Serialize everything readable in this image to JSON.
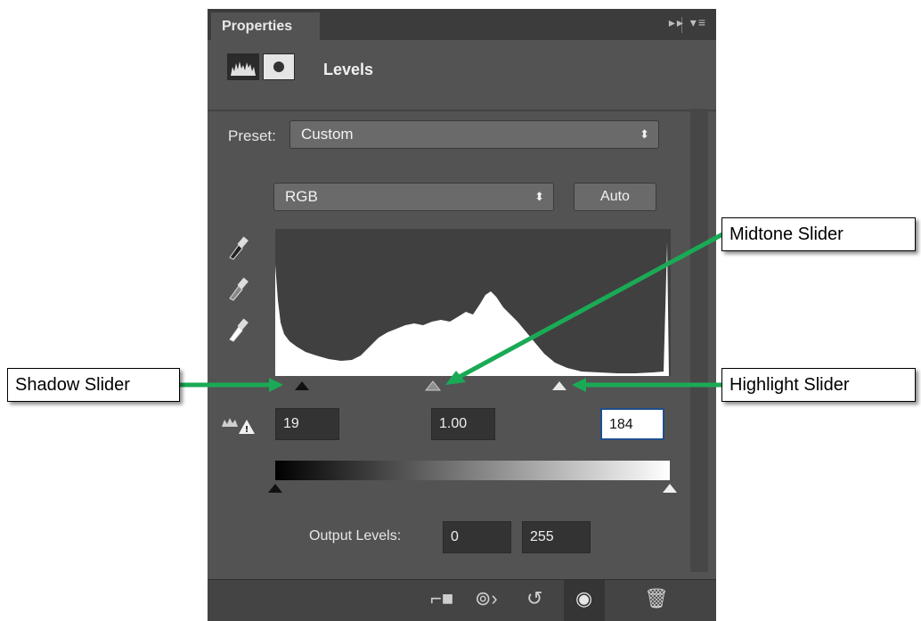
{
  "panel": {
    "tab_label": "Properties",
    "tab_icons": "▸▸ ▾≡",
    "title": "Levels",
    "preset_label": "Preset:",
    "preset_value": "Custom",
    "channel_value": "RGB",
    "auto_label": "Auto"
  },
  "inputs": {
    "shadow": "19",
    "midtone": "1.00",
    "highlight": "184"
  },
  "output": {
    "label": "Output Levels:",
    "low": "0",
    "high": "255"
  },
  "callouts": {
    "midtone": "Midtone Slider",
    "shadow": "Shadow Slider",
    "highlight": "Highlight Slider"
  },
  "colors": {
    "panel_bg": "#535353",
    "arrow_green": "#1aaa55"
  }
}
